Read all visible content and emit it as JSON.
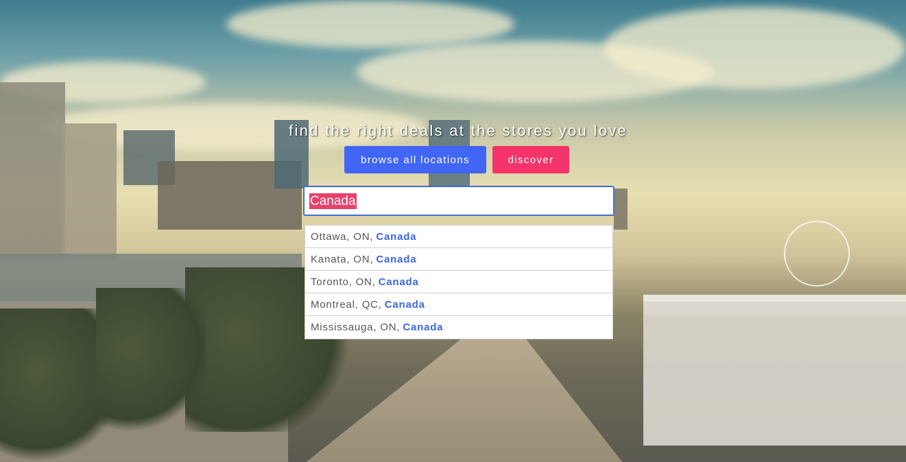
{
  "hero": {
    "tagline": "find the right deals at the stores you love"
  },
  "buttons": {
    "browse_label": "browse all locations",
    "discover_label": "discover"
  },
  "search": {
    "value": "Canada"
  },
  "suggestions": [
    {
      "place": "Ottawa, ON,",
      "country": "Canada"
    },
    {
      "place": "Kanata, ON,",
      "country": "Canada"
    },
    {
      "place": "Toronto, ON,",
      "country": "Canada"
    },
    {
      "place": "Montreal, QC,",
      "country": "Canada"
    },
    {
      "place": "Mississauga, ON,",
      "country": "Canada"
    }
  ],
  "colors": {
    "browse_button": "#4166f5",
    "discover_button": "#f4336a",
    "highlight": "#e8406c",
    "country_text": "#3d66e0"
  }
}
